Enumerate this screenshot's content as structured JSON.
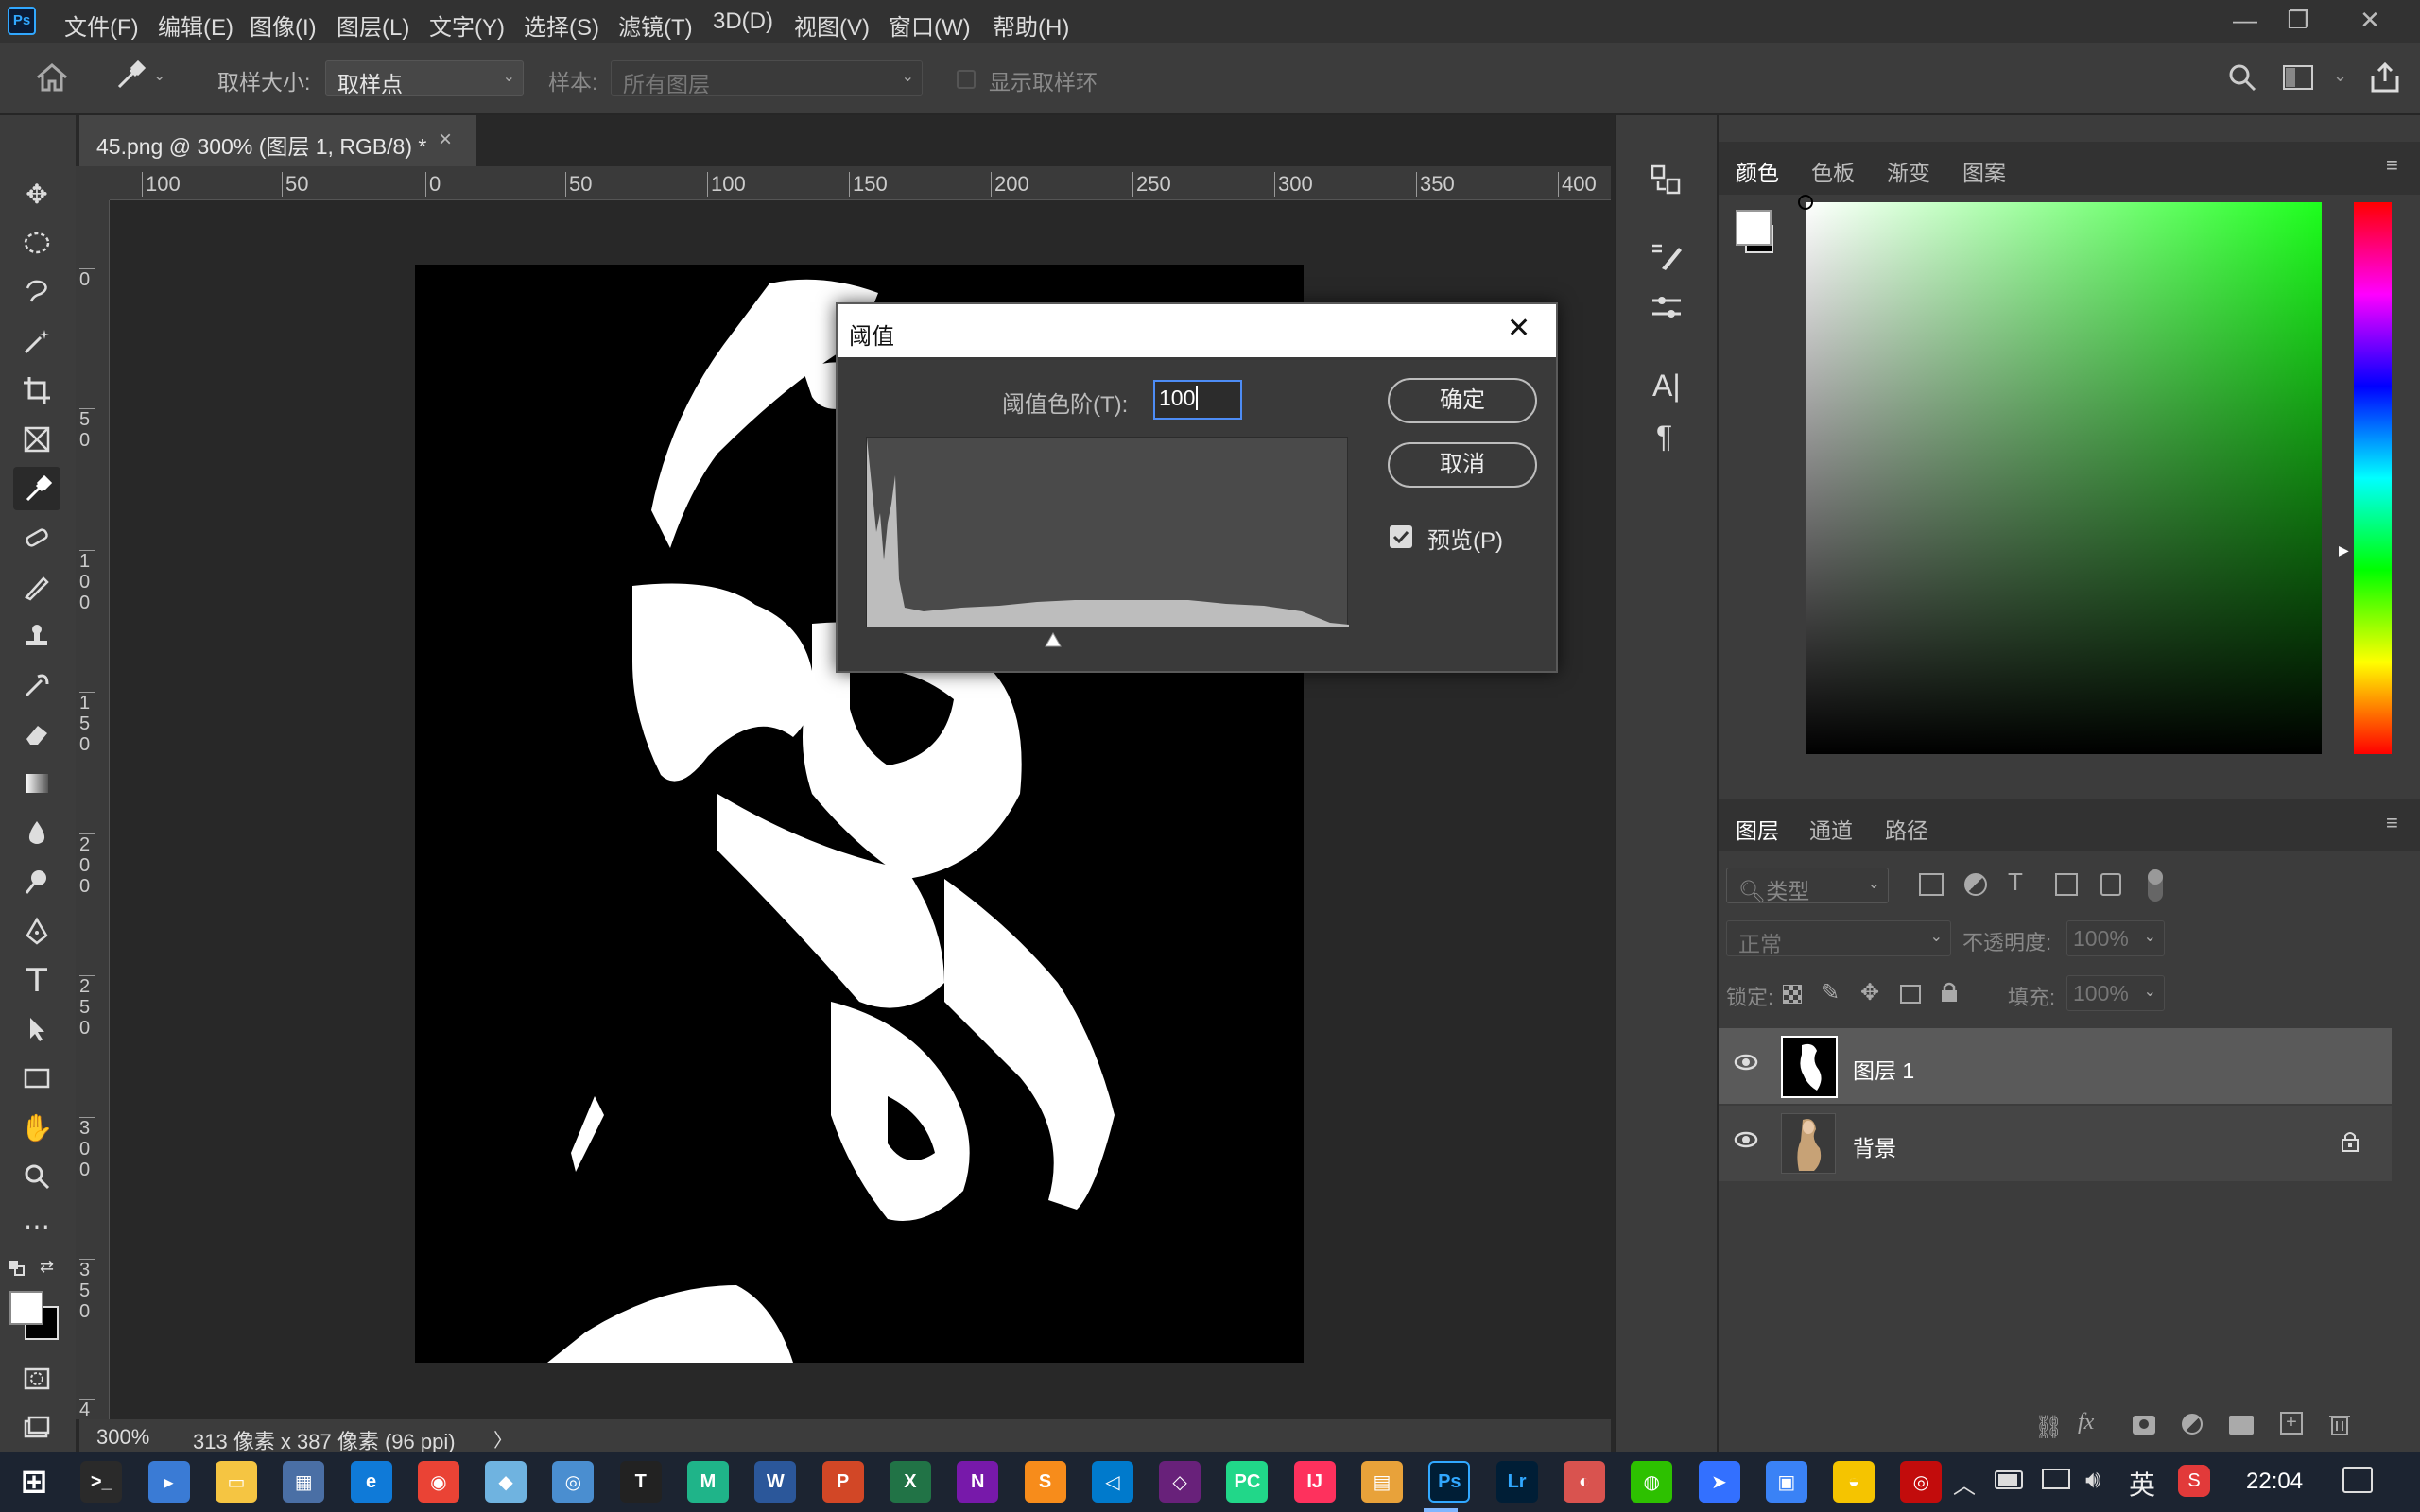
{
  "app": {
    "logo": "Ps"
  },
  "menu": [
    "文件(F)",
    "编辑(E)",
    "图像(I)",
    "图层(L)",
    "文字(Y)",
    "选择(S)",
    "滤镜(T)",
    "3D(D)",
    "视图(V)",
    "窗口(W)",
    "帮助(H)"
  ],
  "options": {
    "sample_size_label": "取样大小:",
    "sample_size_value": "取样点",
    "sample_label": "样本:",
    "sample_value": "所有图层",
    "show_ring_label": "显示取样环"
  },
  "document": {
    "tab_title": "45.png @ 300% (图层 1, RGB/8) *",
    "close": "×",
    "ruler_h": [
      "100",
      "50",
      "0",
      "50",
      "100",
      "150",
      "200",
      "250",
      "300",
      "350",
      "400"
    ],
    "ruler_v": [
      "0",
      "50",
      "100",
      "150",
      "200",
      "250",
      "300",
      "350",
      "4"
    ]
  },
  "status": {
    "zoom": "300%",
    "info": "313 像素 x 387 像素 (96 ppi)",
    "arrow": "〉"
  },
  "dialog": {
    "title": "阈值",
    "level_label": "阈值色阶(T):",
    "level_value": "100",
    "ok": "确定",
    "cancel": "取消",
    "preview_label": "预览(P)",
    "preview_checked": true
  },
  "color_panel": {
    "tabs": [
      "颜色",
      "色板",
      "渐变",
      "图案"
    ],
    "active_tab": 0
  },
  "layers_panel": {
    "tabs": [
      "图层",
      "通道",
      "路径"
    ],
    "active_tab": 0,
    "filter_placeholder": "类型",
    "blend_mode": "正常",
    "opacity_label": "不透明度:",
    "opacity_value": "100%",
    "lock_label": "锁定:",
    "fill_label": "填充:",
    "fill_value": "100%",
    "layers": [
      {
        "name": "图层 1",
        "selected": true,
        "visible": true,
        "locked": false
      },
      {
        "name": "背景",
        "selected": false,
        "visible": true,
        "locked": true
      }
    ]
  },
  "dock_text": {
    "type_icon": "A|",
    "para_icon": "¶"
  },
  "taskbar": {
    "time": "22:04",
    "ime": "英",
    "apps": [
      "Start",
      "Terminal",
      "Finder",
      "Explorer",
      "Calculator",
      "Edge",
      "Chrome",
      "Files",
      "Browser",
      "Typora",
      "Meister",
      "Word",
      "PowerPoint",
      "Excel",
      "OneNote",
      "Sublime",
      "VSCode",
      "VisualStudio",
      "PyCharm",
      "IntelliJ",
      "Notes",
      "Photoshop",
      "Lightroom",
      "Bird",
      "WeChat",
      "Feishu",
      "Store",
      "Qihu",
      "NetEase"
    ]
  },
  "colors": {
    "accent_blue": "#4d8cf5",
    "panel": "#3c3c3c",
    "dark": "#282828"
  }
}
